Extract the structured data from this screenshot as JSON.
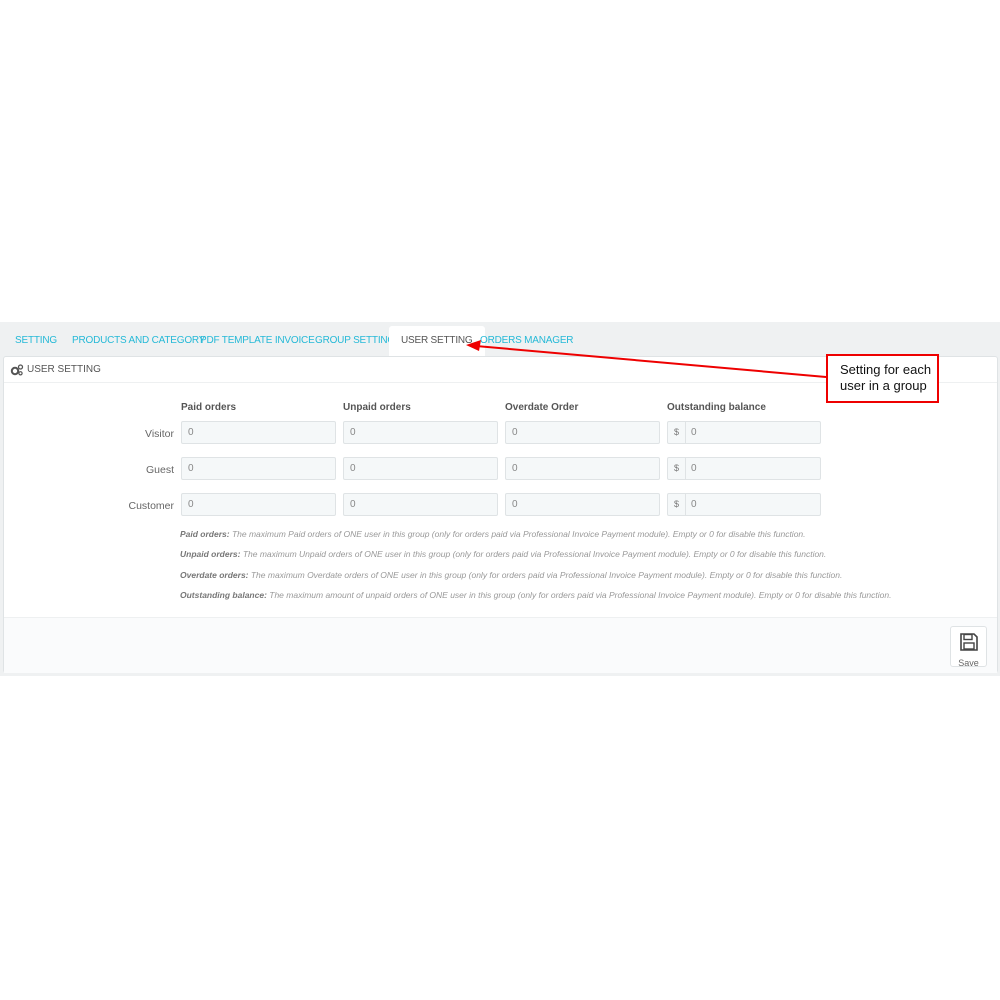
{
  "tabs": [
    {
      "label": "SETTING",
      "active": false
    },
    {
      "label": "PRODUCTS AND CATEGORY",
      "active": false
    },
    {
      "label": "PDF TEMPLATE INVOICE",
      "active": false
    },
    {
      "label": "GROUP SETTING",
      "active": false
    },
    {
      "label": "USER SETTING",
      "active": true
    },
    {
      "label": "ORDERS MANAGER",
      "active": false
    }
  ],
  "panel": {
    "title": "USER SETTING",
    "title_icon": "gears-icon",
    "columns": [
      "Paid orders",
      "Unpaid orders",
      "Overdate Order",
      "Outstanding balance"
    ],
    "currency_symbol": "$",
    "rows": [
      {
        "label": "Visitor",
        "values": [
          "0",
          "0",
          "0",
          "0"
        ]
      },
      {
        "label": "Guest",
        "values": [
          "0",
          "0",
          "0",
          "0"
        ]
      },
      {
        "label": "Customer",
        "values": [
          "0",
          "0",
          "0",
          "0"
        ]
      }
    ],
    "help": [
      {
        "term": "Paid orders:",
        "text": " The maximum Paid orders of ONE user in this group (only for orders paid via Professional Invoice Payment module). Empty or 0 for disable this function."
      },
      {
        "term": "Unpaid orders:",
        "text": " The maximum Unpaid orders of ONE user in this group (only for orders paid via Professional Invoice Payment module). Empty or 0 for disable this function."
      },
      {
        "term": "Overdate orders:",
        "text": " The maximum Overdate orders of ONE user in this group (only for orders paid via Professional Invoice Payment module). Empty or 0 for disable this function."
      },
      {
        "term": "Outstanding balance:",
        "text": " The maximum amount of unpaid orders of ONE user in this group (only for orders paid via Professional Invoice Payment module). Empty or 0 for disable this function."
      }
    ],
    "save_label": "Save",
    "save_icon": "floppy-disk-icon"
  },
  "annotation": {
    "text_line1": "Setting for each",
    "text_line2": "user in a group",
    "color": "#ee0000"
  }
}
